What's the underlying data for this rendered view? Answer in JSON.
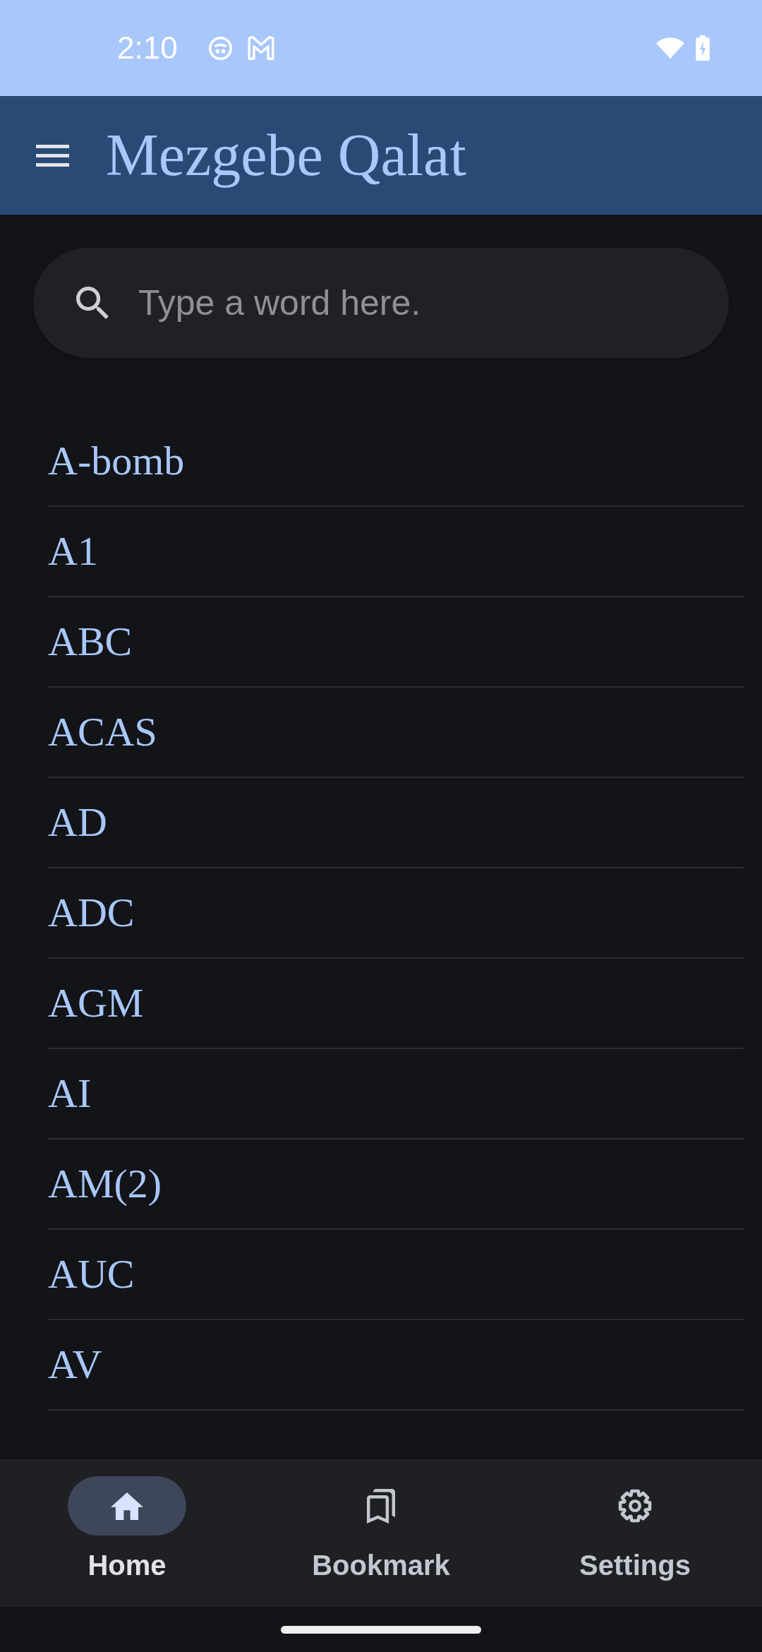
{
  "status_bar": {
    "time": "2:10"
  },
  "app_bar": {
    "title": "Mezgebe Qalat"
  },
  "search": {
    "placeholder": "Type a word here."
  },
  "words": [
    "A-bomb",
    "A1",
    "ABC",
    "ACAS",
    "AD",
    "ADC",
    "AGM",
    "AI",
    "AM(2)",
    "AUC",
    "AV"
  ],
  "bottom_nav": [
    {
      "label": "Home",
      "selected": true
    },
    {
      "label": "Bookmark",
      "selected": false
    },
    {
      "label": "Settings",
      "selected": false
    }
  ]
}
